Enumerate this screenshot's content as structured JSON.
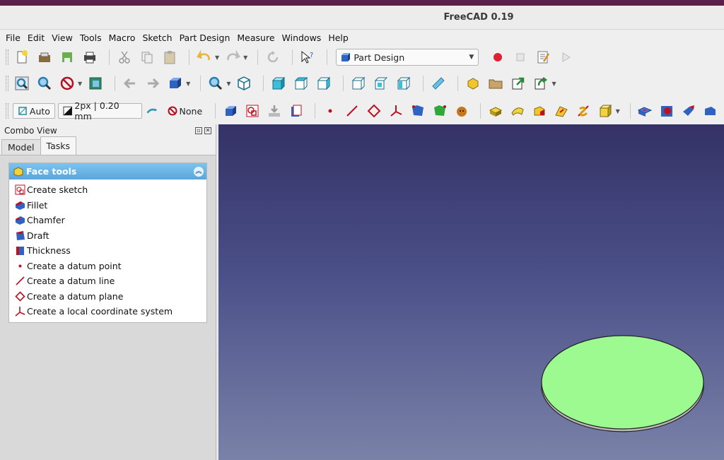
{
  "window": {
    "title": "FreeCAD 0.19"
  },
  "menu": [
    {
      "label": "File"
    },
    {
      "label": "Edit"
    },
    {
      "label": "View"
    },
    {
      "label": "Tools"
    },
    {
      "label": "Macro"
    },
    {
      "label": "Sketch"
    },
    {
      "label": "Part Design"
    },
    {
      "label": "Measure"
    },
    {
      "label": "Windows"
    },
    {
      "label": "Help"
    }
  ],
  "toolbar": {
    "workbench": "Part Design",
    "draw_style": "Auto",
    "line_width": "2px | 0.20 mm",
    "selection_filter": "None"
  },
  "combo": {
    "title": "Combo View",
    "tabs": [
      {
        "label": "Model"
      },
      {
        "label": "Tasks"
      }
    ],
    "active_tab": "Tasks"
  },
  "task_panel": {
    "title": "Face tools",
    "items": [
      {
        "label": "Create sketch",
        "icon": "sketch-icon"
      },
      {
        "label": "Fillet",
        "icon": "fillet-icon"
      },
      {
        "label": "Chamfer",
        "icon": "chamfer-icon"
      },
      {
        "label": "Draft",
        "icon": "draft-icon"
      },
      {
        "label": "Thickness",
        "icon": "thickness-icon"
      },
      {
        "label": "Create a datum point",
        "icon": "datum-point-icon"
      },
      {
        "label": "Create a datum line",
        "icon": "datum-line-icon"
      },
      {
        "label": "Create a datum plane",
        "icon": "datum-plane-icon"
      },
      {
        "label": "Create a local coordinate system",
        "icon": "coordinate-system-icon"
      }
    ]
  },
  "colors": {
    "accent": "#5aa6dc",
    "viewport_top": "#343266",
    "viewport_bottom": "#7a82a8",
    "cylinder_face": "#9dfa90"
  }
}
